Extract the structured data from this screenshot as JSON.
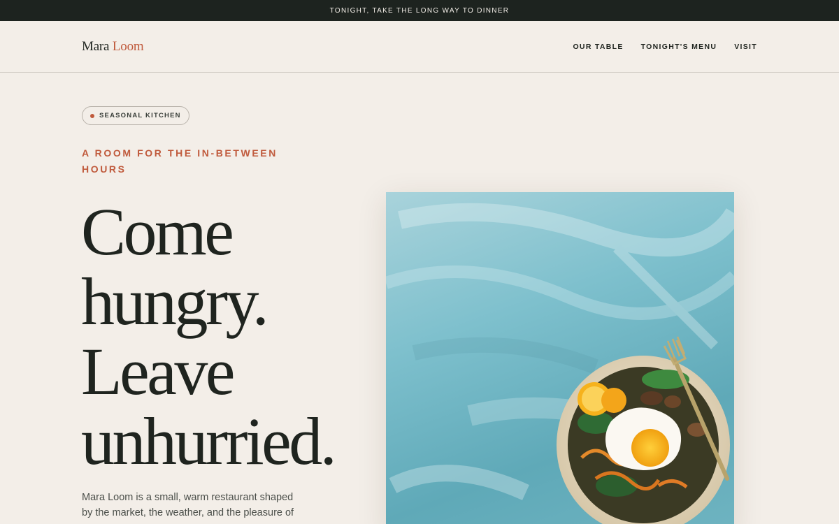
{
  "announcement": "TONIGHT, TAKE THE LONG WAY TO DINNER",
  "brand": {
    "first": "Mara",
    "second": "Loom",
    "accent_color": "#c05a3c"
  },
  "nav": {
    "links": [
      "OUR TABLE",
      "TONIGHT'S MENU",
      "VISIT"
    ]
  },
  "hero": {
    "badge": "SEASONAL KITCHEN",
    "eyebrow": "A ROOM FOR THE IN-BETWEEN HOURS",
    "headline": [
      "Come",
      "hungry.",
      "Leave",
      "unhurried."
    ],
    "intro": "Mara Loom is a small, warm restaurant shaped by the market, the weather, and the pleasure of"
  },
  "colors": {
    "background": "#f3eee8",
    "topbar": "#1d231f",
    "ink": "#1f241f",
    "accent": "#c05a3c"
  },
  "icons": {
    "badge_dot": "dot-icon",
    "fork": "fork-icon"
  }
}
